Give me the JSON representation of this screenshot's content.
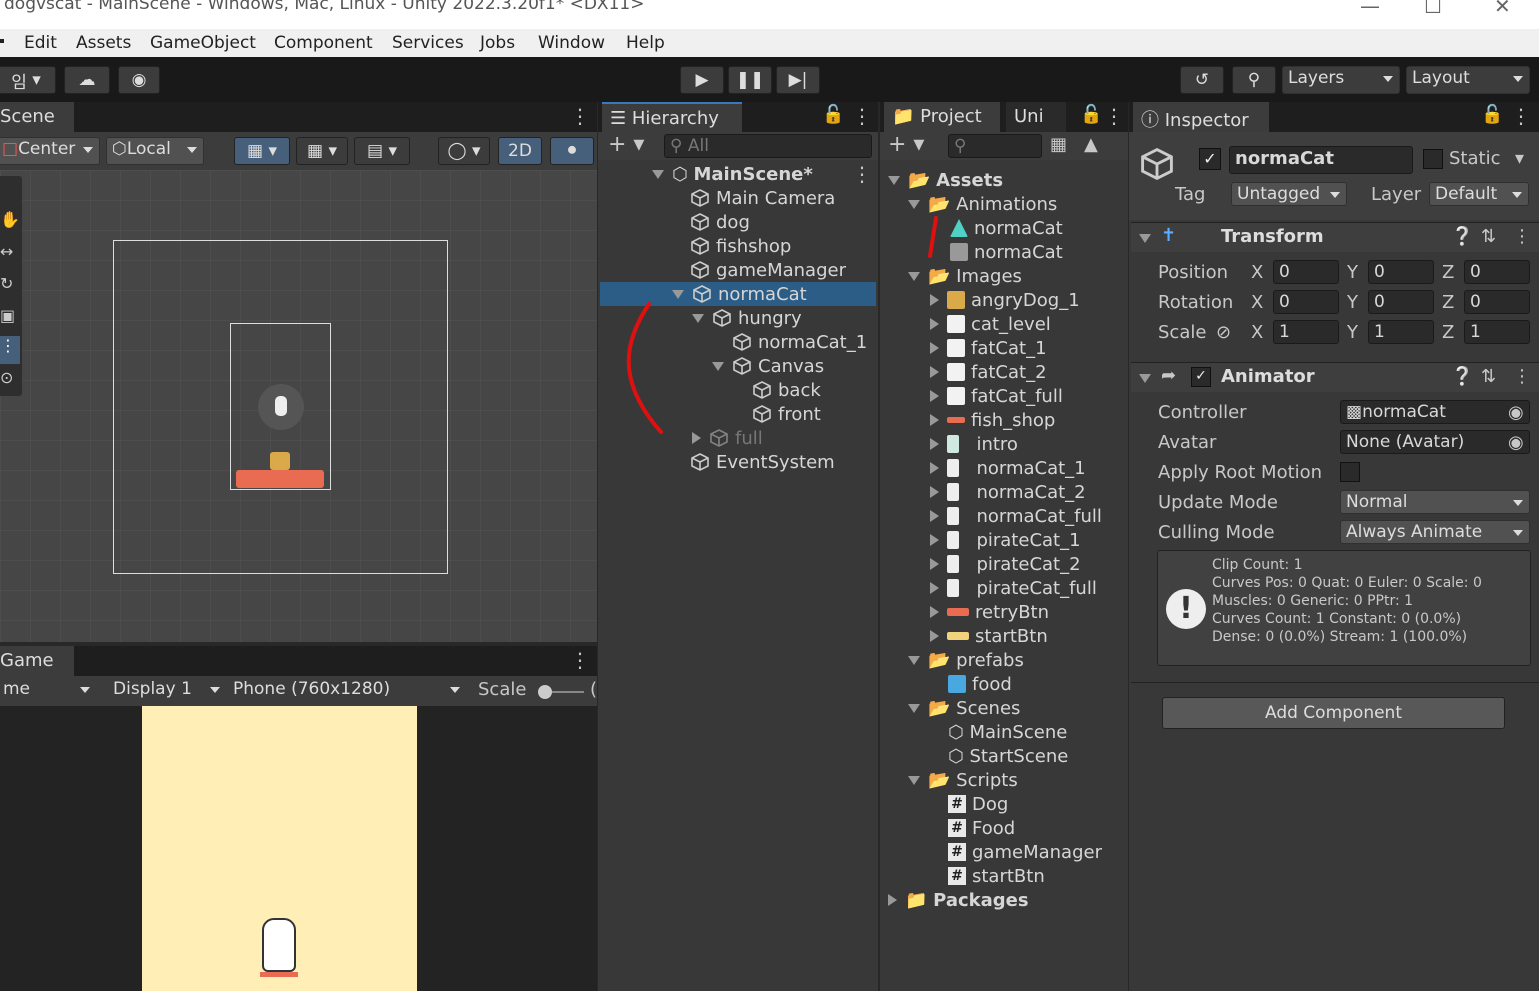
{
  "window": {
    "title": "dogvscat - MainScene - Windows, Mac, Linux - Unity 2022.3.20f1* <DX11>"
  },
  "menu": [
    "Edit",
    "Assets",
    "GameObject",
    "Component",
    "Services",
    "Jobs",
    "Window",
    "Help"
  ],
  "toolbar": {
    "layers": "Layers",
    "layout": "Layout",
    "account_initial": "임"
  },
  "scene": {
    "tab": "Scene",
    "pivot": "Center",
    "space": "Local",
    "mode_2d": "2D"
  },
  "game": {
    "tab": "Game",
    "view": "me",
    "display": "Display 1",
    "resolution": "Phone (760x1280)",
    "scale_label": "Scale",
    "scale_value": "("
  },
  "hierarchy": {
    "tab": "Hierarchy",
    "search_placeholder": "All",
    "scene": "MainScene*",
    "items": [
      "Main Camera",
      "dog",
      "fishshop",
      "gameManager",
      "normaCat",
      "hungry",
      "normaCat_1",
      "Canvas",
      "back",
      "front",
      "full",
      "EventSystem"
    ]
  },
  "project": {
    "tabs": [
      "Project",
      "Uni"
    ],
    "root": "Assets",
    "animations": {
      "folder": "Animations",
      "items": [
        "normaCat",
        "normaCat"
      ]
    },
    "images": {
      "folder": "Images",
      "items": [
        "angryDog_1",
        "cat_level",
        "fatCat_1",
        "fatCat_2",
        "fatCat_full",
        "fish_shop",
        "intro",
        "normaCat_1",
        "normaCat_2",
        "normaCat_full",
        "pirateCat_1",
        "pirateCat_2",
        "pirateCat_full",
        "retryBtn",
        "startBtn"
      ]
    },
    "prefabs": {
      "folder": "prefabs",
      "items": [
        "food"
      ]
    },
    "scenes": {
      "folder": "Scenes",
      "items": [
        "MainScene",
        "StartScene"
      ]
    },
    "scripts": {
      "folder": "Scripts",
      "items": [
        "Dog",
        "Food",
        "gameManager",
        "startBtn"
      ]
    },
    "packages": "Packages"
  },
  "inspector": {
    "tab": "Inspector",
    "object_name": "normaCat",
    "static": "Static",
    "tag_label": "Tag",
    "tag": "Untagged",
    "layer_label": "Layer",
    "layer": "Default",
    "transform": {
      "title": "Transform",
      "rows": [
        {
          "label": "Position",
          "x": "0",
          "y": "0",
          "z": "0"
        },
        {
          "label": "Rotation",
          "x": "0",
          "y": "0",
          "z": "0"
        },
        {
          "label": "Scale",
          "x": "1",
          "y": "1",
          "z": "1"
        }
      ]
    },
    "animator": {
      "title": "Animator",
      "controller_label": "Controller",
      "controller": "normaCat",
      "avatar_label": "Avatar",
      "avatar": "None (Avatar)",
      "root_motion_label": "Apply Root Motion",
      "update_label": "Update Mode",
      "update": "Normal",
      "culling_label": "Culling Mode",
      "culling": "Always Animate",
      "info": [
        "Clip Count: 1",
        "Curves Pos: 0 Quat: 0 Euler: 0 Scale: 0",
        "Muscles: 0 Generic: 0 PPtr: 1",
        "Curves Count: 1 Constant: 0 (0.0%)",
        "Dense: 0 (0.0%) Stream: 1 (100.0%)"
      ]
    },
    "add_component": "Add Component"
  },
  "colors": {
    "selection": "#2c5d87",
    "annotation": "#e01010",
    "game_bg": "#ffeeb5"
  }
}
